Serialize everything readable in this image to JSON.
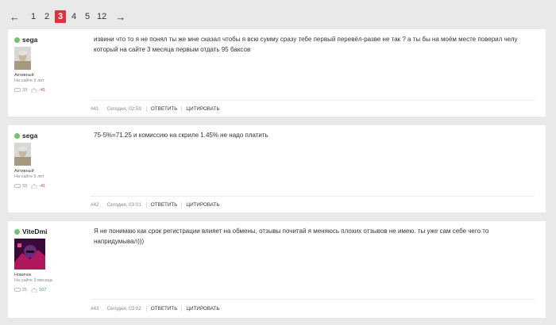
{
  "pagination": {
    "prev": "←",
    "pages": [
      "1",
      "2",
      "3",
      "4",
      "5",
      "12"
    ],
    "active": "3",
    "next": "→"
  },
  "posts": [
    {
      "author": "sega",
      "rank": "Активный",
      "since": "На сайте 9 лет",
      "comments": "33",
      "rating": "-41",
      "text": "извини что то я не понял ты же мне сказал чтобы я всю сумму сразу тебе первый перевёл-разве не так ? а ты бы на моём месте поверил челу который на сайте 3 месяца первым отдать 95 баксов",
      "number": "#41",
      "time": "Сегодня, 02:59",
      "reply": "ОТВЕТИТЬ",
      "quote": "ЦИТИРОВАТЬ"
    },
    {
      "author": "sega",
      "rank": "Активный",
      "since": "На сайте 9 лет",
      "comments": "33",
      "rating": "-41",
      "text": "75-5%=71.25 и комиссию на скриле 1.45% не надо платить",
      "number": "#42",
      "time": "Сегодня, 03:01",
      "reply": "ОТВЕТИТЬ",
      "quote": "ЦИТИРОВАТЬ"
    },
    {
      "author": "ViteDmi",
      "rank": "Новичок",
      "since": "На сайте 3 месяца",
      "comments": "25",
      "rating": "107",
      "text": "Я не понимаю как срок регистрации влияет на обмены, отзывы почитай я меняюсь плохих отзывов не имею. ты уже сам себе чего то напридумывал)))",
      "number": "#43",
      "time": "Сегодня, 03:02",
      "reply": "ОТВЕТИТЬ",
      "quote": "ЦИТИРОВАТЬ"
    }
  ],
  "colors": {
    "accent": "#e0323e",
    "online": "#6dc66d",
    "negative": "#d23b3b",
    "positive": "#3c9a3c"
  },
  "icons": {
    "online": "online-status-dot",
    "comments": "speech-bubble-icon",
    "rating": "thumbs-icon"
  }
}
